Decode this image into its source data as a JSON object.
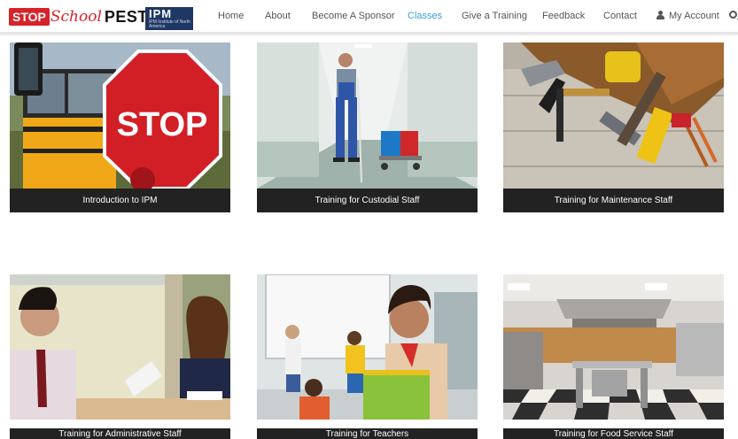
{
  "header": {
    "logo": {
      "stop": "STOP",
      "school": "School",
      "pests": "PESTS"
    },
    "ipm_logo": {
      "big": "IPM",
      "small": "IPM Institute of North America"
    }
  },
  "nav": {
    "items": [
      "Home",
      "About",
      "Become A Sponsor",
      "Classes",
      "Give a Training",
      "Feedback",
      "Contact"
    ],
    "active": "Classes",
    "account": "My Account"
  },
  "cards": [
    {
      "label": "Introduction to IPM",
      "icon": "stop-sign-school-bus-image"
    },
    {
      "label": "Training for Custodial Staff",
      "icon": "custodian-with-mop-image"
    },
    {
      "label": "Training for Maintenance Staff",
      "icon": "tool-belt-image"
    },
    {
      "label": "Training for Administrative Staff",
      "icon": "office-staff-image"
    },
    {
      "label": "Training for Teachers",
      "icon": "teacher-classroom-image"
    },
    {
      "label": "Training for Food Service Staff",
      "icon": "school-kitchen-image"
    }
  ],
  "colors": {
    "brand_red": "#d62329",
    "active_nav": "#3aa0d5",
    "card_label_bg": "#222222",
    "ipm_blue": "#1f3763"
  }
}
